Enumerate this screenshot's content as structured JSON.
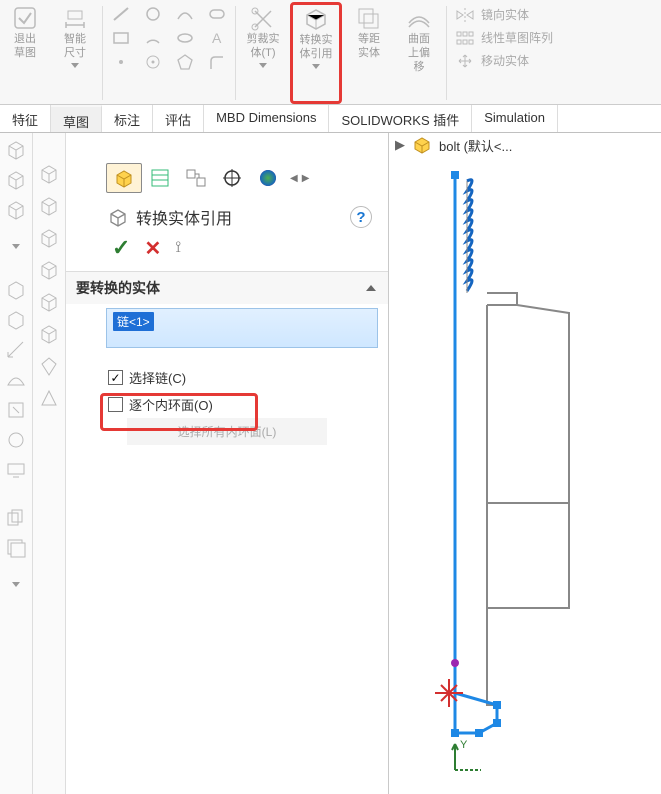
{
  "ribbon": {
    "groups": [
      {
        "label1": "退出",
        "label2": "草图"
      },
      {
        "label1": "智能",
        "label2": "尺寸"
      }
    ],
    "trim": {
      "l1": "剪裁实",
      "l2": "体(T)"
    },
    "convert": {
      "l1": "转换实",
      "l2": "体引用"
    },
    "offset": {
      "l1": "等距",
      "l2": "实体"
    },
    "surf": {
      "l1": "曲面",
      "l2": "上偏",
      "l3": "移"
    },
    "right": {
      "mirror": "镜向实体",
      "pattern": "线性草图阵列",
      "move": "移动实体"
    }
  },
  "tabs": [
    "特征",
    "草图",
    "标注",
    "评估",
    "MBD Dimensions",
    "SOLIDWORKS 插件",
    "Simulation"
  ],
  "panel": {
    "title": "转换实体引用",
    "section": "要转换的实体",
    "listItem": "链<1>",
    "chk_chain": "选择链(C)",
    "chk_inner": "逐个内环面(O)",
    "btn_all": "选择所有内环面(L)",
    "help": "?"
  },
  "crumb": {
    "part": "bolt  (默认<..."
  },
  "axis": {
    "y": "Y"
  }
}
